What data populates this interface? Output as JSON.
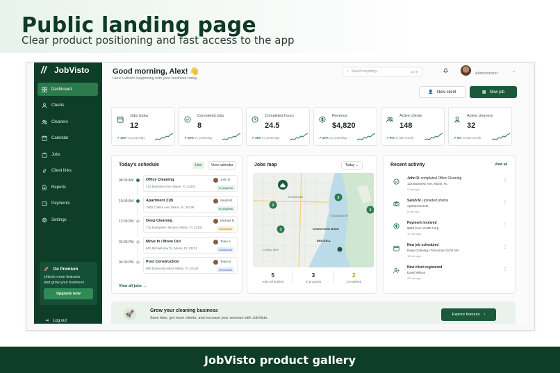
{
  "hero": {
    "title": "Public landing page",
    "subtitle": "Clear product positioning and fast access to the app"
  },
  "footer": {
    "label": "JobVisto product gallery"
  },
  "app": {
    "brand": "JobVisto",
    "nav": [
      {
        "label": "Dashboard",
        "icon": "grid-icon",
        "active": true
      },
      {
        "label": "Clients",
        "icon": "user-icon"
      },
      {
        "label": "Cleaners",
        "icon": "users-icon"
      },
      {
        "label": "Calendar",
        "icon": "calendar-icon"
      },
      {
        "label": "Jobs",
        "icon": "briefcase-icon"
      },
      {
        "label": "Client links",
        "icon": "link-icon"
      },
      {
        "label": "Reports",
        "icon": "file-icon"
      },
      {
        "label": "Payments",
        "icon": "wallet-icon"
      },
      {
        "label": "Settings",
        "icon": "gear-icon"
      }
    ],
    "premium": {
      "title": "Go Premium",
      "text1": "Unlock more features",
      "text2": "and grow your business.",
      "button": "Upgrade now"
    },
    "logout": "Log out",
    "greeting": "Good morning, Alex! 👋",
    "greeting_sub": "Here's what's happening with your business today.",
    "search": {
      "placeholder": "Search anything...",
      "shortcut": "Ctrl K"
    },
    "user_role": "Administrator",
    "buttons": {
      "new_client": "New client",
      "new_job": "New job"
    },
    "stats": [
      {
        "label": "Jobs today",
        "value": "12",
        "delta": "↗ 15%",
        "compare": "vs yesterday",
        "icon": "calendar-icon"
      },
      {
        "label": "Completed jobs",
        "value": "8",
        "delta": "↗ 20%",
        "compare": "vs yesterday",
        "icon": "check-circle-icon"
      },
      {
        "label": "Completed hours",
        "value": "24.5",
        "delta": "↗ 18%",
        "compare": "vs yesterday",
        "icon": "clock-icon"
      },
      {
        "label": "Revenue",
        "value": "$4,820",
        "delta": "↗ 22%",
        "compare": "vs yesterday",
        "icon": "dollar-icon"
      },
      {
        "label": "Active clients",
        "value": "148",
        "delta": "↗ 9%",
        "compare": "vs last month",
        "icon": "users-icon"
      },
      {
        "label": "Active cleaners",
        "value": "32",
        "delta": "↗ 6%",
        "compare": "vs last month",
        "icon": "user-check-icon"
      }
    ],
    "schedule": {
      "title": "Today's schedule",
      "live": "Live",
      "view_calendar": "View calendar",
      "view_all": "View all jobs →",
      "rows": [
        {
          "time": "08:00 AM",
          "name": "Office Cleaning",
          "addr": "123 Business Ave, Miami, FL 33101",
          "who": "John D.",
          "status": "In progress",
          "kind": "progress",
          "active": true
        },
        {
          "time": "10:00 AM",
          "name": "Apartment 21B",
          "addr": "1800 Collins Ave, Miami, FL 33139",
          "who": "Sarah M.",
          "status": "In progress",
          "kind": "progress",
          "active": true
        },
        {
          "time": "12:00 PM",
          "name": "Deep Cleaning",
          "addr": "742 Evergreen Terrace, Miami, FL 33101",
          "who": "Michael R.",
          "status": "Scheduled",
          "kind": "scheduled",
          "active": false
        },
        {
          "time": "02:00 PM",
          "name": "Move In / Move Out",
          "addr": "600 Brickell Key Dr, Miami, FL 33131",
          "who": "Team A",
          "status": "Scheduled",
          "kind": "blue",
          "active": false
        },
        {
          "time": "04:00 PM",
          "name": "Post Construction",
          "addr": "950 Downtown Blvd, Miami, FL 33132",
          "who": "Team B",
          "status": "Scheduled",
          "kind": "blue",
          "active": false
        }
      ]
    },
    "map": {
      "title": "Jobs map",
      "range": "Today",
      "labels": [
        "WYNWOOD",
        "EDGEWATER",
        "DOWNTOWN MIAMI",
        "BRICKELL",
        "CORAL WAY"
      ],
      "pins": [
        "2",
        "3",
        "5",
        "3"
      ],
      "stats": [
        {
          "value": "5",
          "label": "Jobs scheduled"
        },
        {
          "value": "3",
          "label": "In progress"
        },
        {
          "value": "2",
          "label": "Completed"
        }
      ]
    },
    "activity": {
      "title": "Recent activity",
      "view_all": "View all",
      "rows": [
        {
          "icon": "check-circle-icon",
          "bold": "John D.",
          "text": " completed Office Cleaning",
          "sub": "123 Business Ave, Miami, FL",
          "time": "2 min ago"
        },
        {
          "icon": "camera-icon",
          "bold": "Sarah M.",
          "text": " uploaded photos",
          "sub": "Apartment 21B",
          "time": "5 min ago"
        },
        {
          "icon": "dollar-icon",
          "bold": "Payment received",
          "text": "",
          "sub": "$320 from ACME Corp",
          "time": "12 min ago"
        },
        {
          "icon": "calendar-icon",
          "bold": "New job scheduled",
          "text": "",
          "sub": "Deep Cleaning • Tomorrow 10:00 AM",
          "time": "18 min ago"
        },
        {
          "icon": "user-plus-icon",
          "bold": "New client registered",
          "text": "",
          "sub": "David Wilson",
          "time": "25 min ago"
        }
      ]
    },
    "grow": {
      "title": "Grow your cleaning business",
      "subtitle": "Save time, get more clients, and increase your revenue with JobVisto.",
      "button": "Explore features"
    }
  }
}
